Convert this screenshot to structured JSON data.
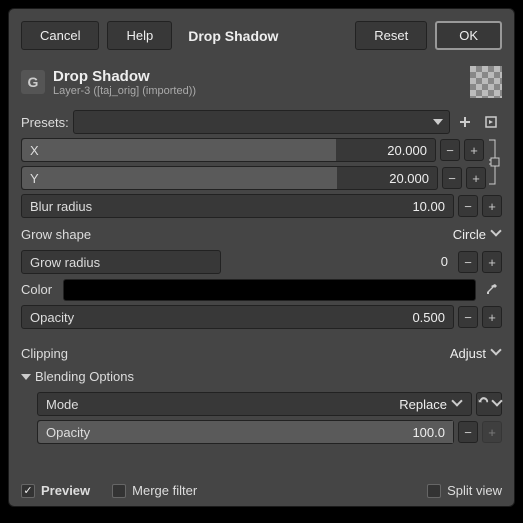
{
  "buttons": {
    "cancel": "Cancel",
    "help": "Help",
    "reset": "Reset",
    "ok": "OK"
  },
  "title": "Drop Shadow",
  "header": {
    "icon": "G",
    "title": "Drop Shadow",
    "subtitle": "Layer-3 ([taj_orig] (imported))"
  },
  "labels": {
    "presets": "Presets:",
    "x": "X",
    "y": "Y",
    "blur": "Blur radius",
    "growshape": "Grow shape",
    "growradius": "Grow radius",
    "color": "Color",
    "opacity": "Opacity",
    "clipping": "Clipping",
    "blending": "Blending Options",
    "mode": "Mode",
    "bopacity": "Opacity",
    "preview": "Preview",
    "merge": "Merge filter",
    "split": "Split view"
  },
  "values": {
    "x": "20.000",
    "y": "20.000",
    "blur": "10.00",
    "growshape": "Circle",
    "growradius": "0",
    "opacity": "0.500",
    "clipping": "Adjust",
    "mode": "Replace",
    "bopacity": "100.0"
  }
}
